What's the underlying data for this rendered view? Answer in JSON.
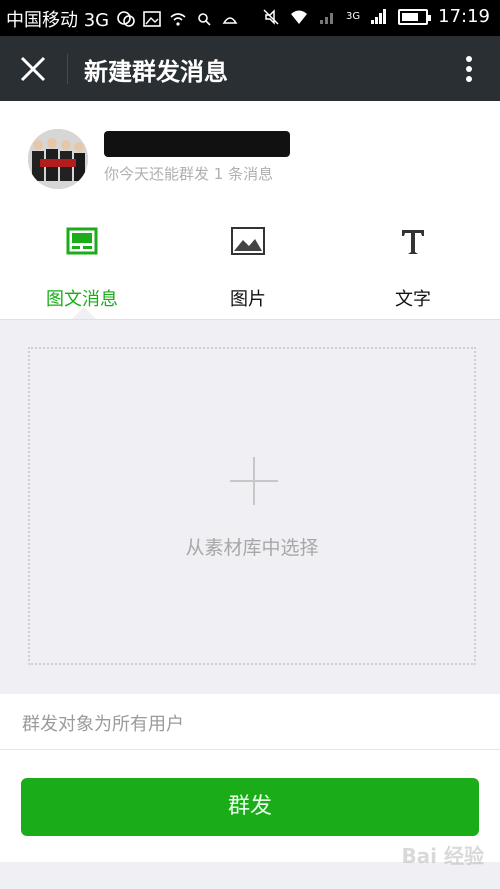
{
  "status_bar": {
    "carrier": "中国移动 3G",
    "time": "17:19",
    "network": "3G"
  },
  "header": {
    "title": "新建群发消息",
    "close_icon": "close-icon",
    "more_icon": "more-vert-icon"
  },
  "account": {
    "quota_text": "你今天还能群发 1 条消息"
  },
  "tabs": [
    {
      "label": "图文消息",
      "icon": "news-icon",
      "active": true
    },
    {
      "label": "图片",
      "icon": "image-icon",
      "active": false
    },
    {
      "label": "文字",
      "icon": "text-icon",
      "active": false
    }
  ],
  "picker": {
    "label": "从素材库中选择",
    "icon": "plus-icon"
  },
  "audience": {
    "text": "群发对象为所有用户"
  },
  "send_button": {
    "label": "群发"
  },
  "watermark": {
    "text": "Bai 经验"
  },
  "colors": {
    "accent": "#1aad19",
    "header_bg": "#2a2f33",
    "page_bg": "#efeff4"
  }
}
